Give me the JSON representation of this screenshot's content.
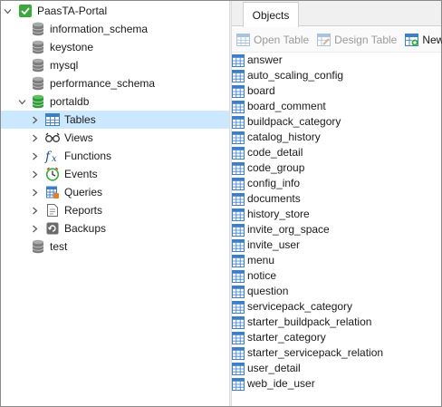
{
  "navigator": {
    "items": [
      {
        "label": "PaasTA-Portal",
        "icon": "connection-icon",
        "level": 0,
        "expanded": true
      },
      {
        "label": "information_schema",
        "icon": "database-icon",
        "level": 1
      },
      {
        "label": "keystone",
        "icon": "database-icon",
        "level": 1
      },
      {
        "label": "mysql",
        "icon": "database-icon",
        "level": 1
      },
      {
        "label": "performance_schema",
        "icon": "database-icon",
        "level": 1
      },
      {
        "label": "portaldb",
        "icon": "database-open-icon",
        "level": 1,
        "expanded": true
      },
      {
        "label": "Tables",
        "icon": "tables-icon",
        "level": 2,
        "selected": true
      },
      {
        "label": "Views",
        "icon": "views-icon",
        "level": 2
      },
      {
        "label": "Functions",
        "icon": "functions-icon",
        "level": 2
      },
      {
        "label": "Events",
        "icon": "events-icon",
        "level": 2
      },
      {
        "label": "Queries",
        "icon": "queries-icon",
        "level": 2
      },
      {
        "label": "Reports",
        "icon": "reports-icon",
        "level": 2
      },
      {
        "label": "Backups",
        "icon": "backups-icon",
        "level": 2
      },
      {
        "label": "test",
        "icon": "database-icon",
        "level": 1
      }
    ]
  },
  "tabs": {
    "objects_label": "Objects"
  },
  "toolbar": {
    "open_table_label": "Open Table",
    "design_table_label": "Design Table",
    "new_table_label": "New"
  },
  "tables": [
    "answer",
    "auto_scaling_config",
    "board",
    "board_comment",
    "buildpack_category",
    "catalog_history",
    "code_detail",
    "code_group",
    "config_info",
    "documents",
    "history_store",
    "invite_org_space",
    "invite_user",
    "menu",
    "notice",
    "question",
    "servicepack_category",
    "starter_buildpack_relation",
    "starter_category",
    "starter_servicepack_relation",
    "user_detail",
    "web_ide_user"
  ],
  "colors": {
    "selection": "#cce8ff",
    "connection_green": "#3aa83a",
    "database_gray": "#7d7d7d",
    "table_blue": "#3c7ec8"
  }
}
